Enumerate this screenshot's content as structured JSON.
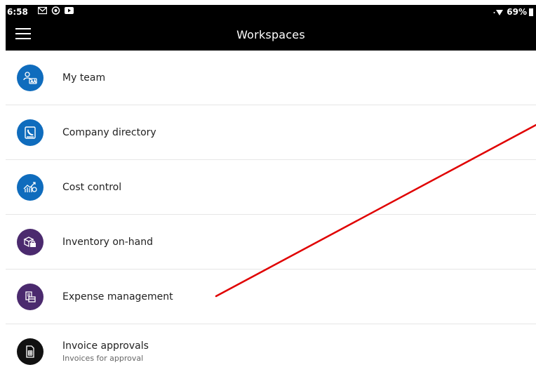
{
  "status_bar": {
    "time": "6:58",
    "battery": "69%",
    "icons": [
      "gmail-icon",
      "sync-icon",
      "media-icon",
      "wifi-icon",
      "battery-icon"
    ]
  },
  "app_bar": {
    "title": "Workspaces"
  },
  "workspaces": [
    {
      "label": "My team",
      "icon": "team-icon",
      "color": "#0f6cbd"
    },
    {
      "label": "Company directory",
      "icon": "directory-icon",
      "color": "#0f6cbd"
    },
    {
      "label": "Cost control",
      "icon": "chart-icon",
      "color": "#0f6cbd"
    },
    {
      "label": "Inventory on-hand",
      "icon": "inventory-icon",
      "color": "#4b2a6e"
    },
    {
      "label": "Expense management",
      "icon": "expense-icon",
      "color": "#4b2a6e"
    },
    {
      "label": "Invoice approvals",
      "sublabel": "Invoices for approval",
      "icon": "invoice-icon",
      "color": "#111111"
    }
  ],
  "annotation": {
    "color": "#e00000"
  }
}
